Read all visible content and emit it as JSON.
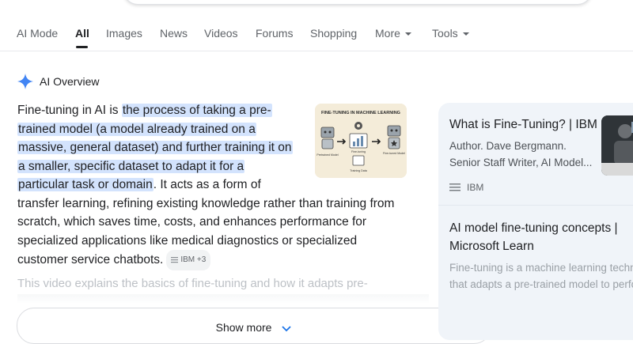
{
  "tabs": [
    {
      "label": "AI Mode"
    },
    {
      "label": "All"
    },
    {
      "label": "Images"
    },
    {
      "label": "News"
    },
    {
      "label": "Videos"
    },
    {
      "label": "Forums"
    },
    {
      "label": "Shopping"
    },
    {
      "label": "More"
    },
    {
      "label": "Tools"
    }
  ],
  "ai_overview": {
    "heading": "AI Overview",
    "lines": [
      {
        "plain": "Fine-tuning in AI is ",
        "hl": "the process of taking a pre-"
      },
      {
        "hl": "trained model (a model already trained on a"
      },
      {
        "hl": "massive, general dataset) and further training it on"
      },
      {
        "hl": "a smaller, specific dataset to adapt it for a"
      },
      {
        "hl": "particular task or domain",
        "plain": ". It acts as a form of"
      },
      {
        "plain": "transfer learning, refining existing knowledge rather than training from"
      },
      {
        "plain": "scratch, which saves time, costs, and enhances performance for"
      },
      {
        "plain": "specialized applications like medical diagnostics or specialized"
      },
      {
        "plain": "customer service chatbots."
      }
    ],
    "source_chip": "IBM +3",
    "faded_text": "This video explains the basics of fine-tuning and how it adapts pre-",
    "show_more": "Show more"
  },
  "image": {
    "title": "FINE-TUNING IN MACHINE LEARNING",
    "label_left": "Pretrained Model",
    "label_mid": "Fine-tuning",
    "label_right": "Fine-tuned Model",
    "label_data": "Training Data"
  },
  "cards": [
    {
      "title": "What is Fine-Tuning? | IBM",
      "author": "Author. Dave Bergmann.",
      "role": "Senior Staff Writer, AI Model...",
      "source": "IBM"
    },
    {
      "title_line1": "AI model fine-tuning concepts |",
      "title_line2": "Microsoft Learn",
      "snippet_line1": "Fine-tuning is a machine learning technique",
      "snippet_line2": "that adapts a pre-trained model to perform"
    }
  ],
  "colors": {
    "highlight": "#d3e3fd",
    "card_bg": "#f0f4f9",
    "ai_sparkle": "#4285f4"
  }
}
